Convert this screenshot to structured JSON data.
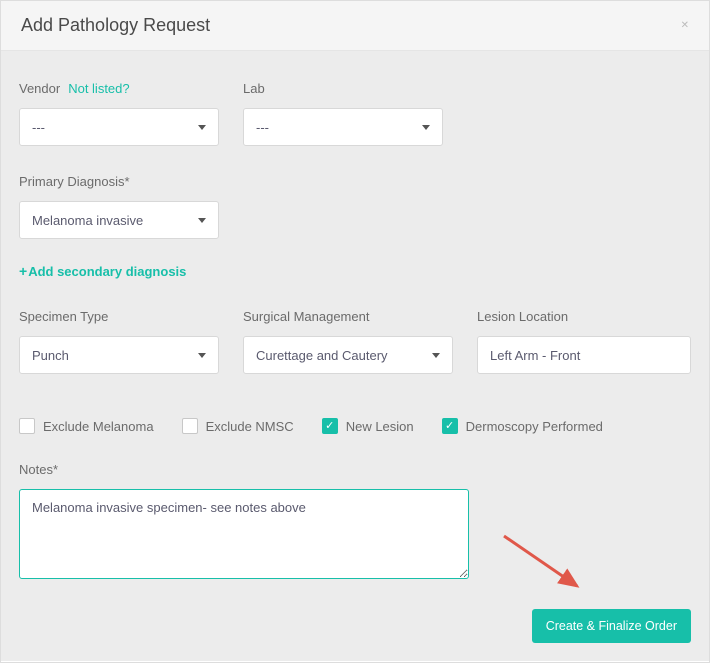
{
  "header": {
    "title": "Add Pathology Request"
  },
  "vendor": {
    "label": "Vendor",
    "hint": "Not listed?",
    "value": "---"
  },
  "lab": {
    "label": "Lab",
    "value": "---"
  },
  "primary_dx": {
    "label": "Primary Diagnosis*",
    "value": "Melanoma invasive"
  },
  "add_secondary_label": "Add secondary diagnosis",
  "specimen_type": {
    "label": "Specimen Type",
    "value": "Punch"
  },
  "surgical_mgmt": {
    "label": "Surgical Management",
    "value": "Curettage and Cautery"
  },
  "lesion_loc": {
    "label": "Lesion Location",
    "value": "Left Arm - Front"
  },
  "checks": {
    "exclude_melanoma": {
      "label": "Exclude Melanoma",
      "checked": false
    },
    "exclude_nmsc": {
      "label": "Exclude NMSC",
      "checked": false
    },
    "new_lesion": {
      "label": "New Lesion",
      "checked": true
    },
    "dermoscopy": {
      "label": "Dermoscopy Performed",
      "checked": true
    }
  },
  "notes": {
    "label": "Notes*",
    "value": "Melanoma invasive specimen- see notes above"
  },
  "finalize_label": "Create & Finalize Order",
  "colors": {
    "teal": "#17bfa9"
  }
}
